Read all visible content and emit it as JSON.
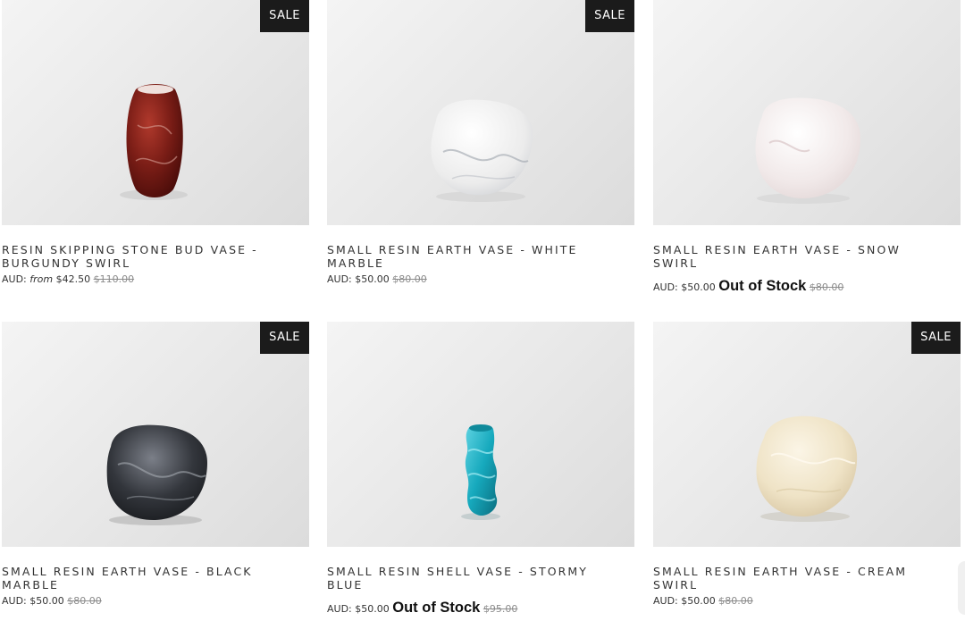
{
  "products": [
    {
      "title": "RESIN SKIPPING STONE BUD VASE - BURGUNDY SWIRL",
      "badge": "SALE",
      "price_prefix": "AUD:",
      "from_label": "from",
      "price": "$42.50",
      "stock_label": "",
      "old_price": "$110.00",
      "image_icon": "burgundy-vase-icon",
      "color": "#7a1d16"
    },
    {
      "title": "SMALL RESIN EARTH VASE - WHITE MARBLE",
      "badge": "SALE",
      "price_prefix": "AUD:",
      "from_label": "",
      "price": "$50.00",
      "stock_label": "",
      "old_price": "$80.00",
      "image_icon": "white-marble-vase-icon",
      "color": "#f2f2f2"
    },
    {
      "title": "SMALL RESIN EARTH VASE - SNOW SWIRL",
      "badge": "",
      "price_prefix": "AUD:",
      "from_label": "",
      "price": "$50.00",
      "stock_label": "Out of Stock",
      "old_price": "$80.00",
      "image_icon": "snow-swirl-vase-icon",
      "color": "#f4eaea"
    },
    {
      "title": "SMALL RESIN EARTH VASE - BLACK MARBLE",
      "badge": "SALE",
      "price_prefix": "AUD:",
      "from_label": "",
      "price": "$50.00",
      "stock_label": "",
      "old_price": "$80.00",
      "image_icon": "black-marble-vase-icon",
      "color": "#33363c"
    },
    {
      "title": "SMALL RESIN SHELL VASE - STORMY BLUE",
      "badge": "",
      "price_prefix": "AUD:",
      "from_label": "",
      "price": "$50.00",
      "stock_label": "Out of Stock",
      "old_price": "$95.00",
      "image_icon": "stormy-blue-vase-icon",
      "color": "#16a9bd"
    },
    {
      "title": "SMALL RESIN EARTH VASE - CREAM SWIRL",
      "badge": "SALE",
      "price_prefix": "AUD:",
      "from_label": "",
      "price": "$50.00",
      "stock_label": "",
      "old_price": "$80.00",
      "image_icon": "cream-swirl-vase-icon",
      "color": "#efe3c6"
    }
  ]
}
